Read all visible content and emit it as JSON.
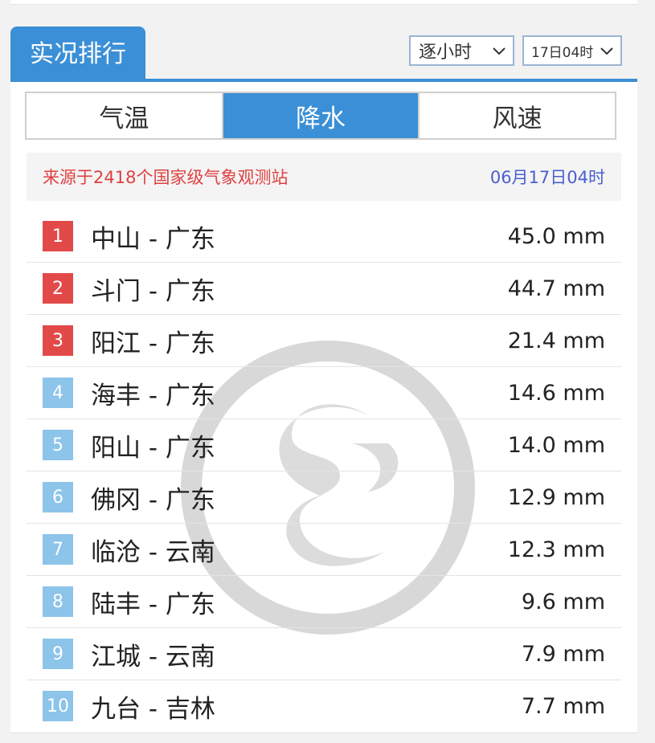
{
  "header": {
    "title": "实况排行",
    "interval_select": "逐小时",
    "time_select": "17日04时"
  },
  "tabs": [
    {
      "label": "气温",
      "active": false
    },
    {
      "label": "降水",
      "active": true
    },
    {
      "label": "风速",
      "active": false
    }
  ],
  "source": {
    "text": "来源于2418个国家级气象观测站",
    "time": "06月17日04时"
  },
  "colors": {
    "accent": "#3b8fd6",
    "top_rank_badge": "#e24a4a",
    "other_rank_badge": "#8cc4ea",
    "source_text": "#e04040",
    "source_time": "#4a5fd0"
  },
  "watermark": {
    "icon": "logo-watermark-icon"
  },
  "rankings": [
    {
      "rank": "1",
      "station": "中山 - 广东",
      "value": "45.0 mm"
    },
    {
      "rank": "2",
      "station": "斗门 - 广东",
      "value": "44.7 mm"
    },
    {
      "rank": "3",
      "station": "阳江 - 广东",
      "value": "21.4 mm"
    },
    {
      "rank": "4",
      "station": "海丰 - 广东",
      "value": "14.6 mm"
    },
    {
      "rank": "5",
      "station": "阳山 - 广东",
      "value": "14.0 mm"
    },
    {
      "rank": "6",
      "station": "佛冈 - 广东",
      "value": "12.9 mm"
    },
    {
      "rank": "7",
      "station": "临沧 - 云南",
      "value": "12.3 mm"
    },
    {
      "rank": "8",
      "station": "陆丰 - 广东",
      "value": "9.6 mm"
    },
    {
      "rank": "9",
      "station": "江城 - 云南",
      "value": "7.9 mm"
    },
    {
      "rank": "10",
      "station": "九台 - 吉林",
      "value": "7.7 mm"
    }
  ]
}
